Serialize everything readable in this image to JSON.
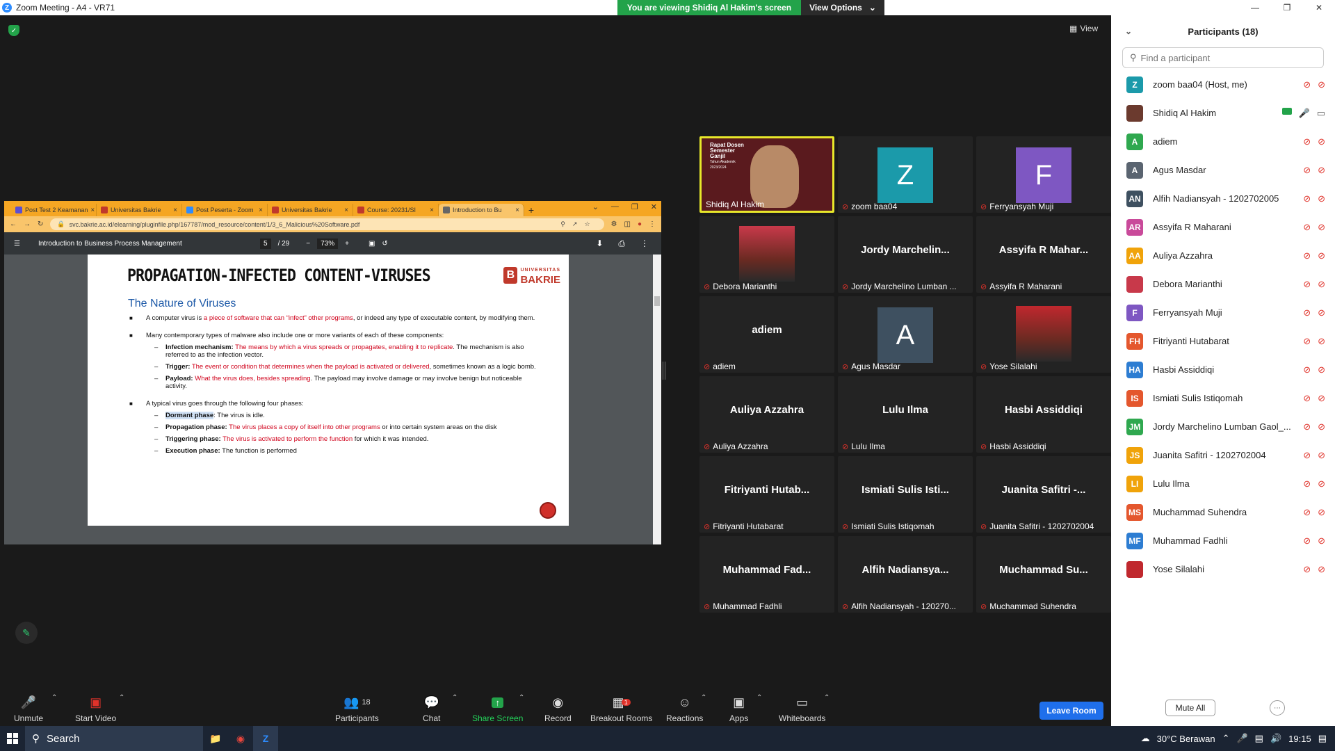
{
  "window": {
    "title": "Zoom Meeting - A4 - VR71"
  },
  "banner": {
    "viewing": "You are viewing Shidiq Al Hakim's screen",
    "view_options": "View Options"
  },
  "view_label": "View",
  "browser": {
    "tabs": [
      {
        "label": "Post Test 2 Keamanan",
        "color": "#5b4fd1"
      },
      {
        "label": "Universitas Bakrie",
        "color": "#c0392b"
      },
      {
        "label": "Post Peserta - Zoom",
        "color": "#2d8cff"
      },
      {
        "label": "Universitas Bakrie",
        "color": "#c0392b"
      },
      {
        "label": "Course: 20231/SI",
        "color": "#c0392b"
      },
      {
        "label": "Introduction to Bu",
        "color": "#666666"
      }
    ],
    "url": "svc.bakrie.ac.id/elearning/pluginfile.php/167787/mod_resource/content/1/3_6_Malicious%20Software.pdf",
    "pdf_title": "Introduction to Business Process Management",
    "page": "5",
    "page_total": "/ 29",
    "zoom": "73%"
  },
  "slide": {
    "title": "PROPAGATION-INFECTED CONTENT-VIRUSES",
    "logo_small": "UNIVERSITAS",
    "logo_big": "BAKRIE",
    "heading": "The Nature of Viruses",
    "b1_a": "A computer virus is ",
    "b1_red": "a piece of software that can “infect” other programs",
    "b1_b": ", or indeed any type of executable content, by modifying them.",
    "b2": "Many contemporary types of malware also include one or more variants of each of these components:",
    "s1_label": "Infection mechanism:",
    "s1_red": " The means by which a virus spreads or propagates, enabling it to replicate",
    "s1_b": ". The mechanism is also referred to as the infection vector.",
    "s2_label": "Trigger:",
    "s2_red": " The event or condition that determines when the payload is activated or delivered",
    "s2_b": ", sometimes known as a logic bomb.",
    "s3_label": "Payload:",
    "s3_red": " What the virus does, besides spreading",
    "s3_b": ". The payload may involve damage or may involve benign but noticeable activity.",
    "b3": "A typical virus goes through the following four phases:",
    "p1_label": "Dormant phase",
    "p1_b": ": The virus is idle.",
    "p2_label": "Propagation phase:",
    "p2_red": " The virus places a copy of itself into other programs",
    "p2_b": " or into certain system areas on the disk",
    "p3_label": "Triggering phase:",
    "p3_red": " The virus is activated to perform the function",
    "p3_b": " for which it was intended.",
    "p4_label": "Execution phase:",
    "p4_b": " The function is performed"
  },
  "tiles": [
    {
      "caption": "Shidiq Al Hakim",
      "type": "slide",
      "slide_text": "Rapat Dosen Semester Ganjil",
      "slide_sub": "Tahun Akademik 2023/2024"
    },
    {
      "caption": "zoom baa04",
      "type": "letter",
      "letter": "Z",
      "color": "#1b9aaa"
    },
    {
      "caption": "Ferryansyah Muji",
      "type": "letter",
      "letter": "F",
      "color": "#7e57c2"
    },
    {
      "caption": "Debora Marianthi",
      "type": "photo",
      "color": "#c8394a"
    },
    {
      "caption": "Jordy Marchelino Lumban ...",
      "type": "name",
      "name": "Jordy Marchelin..."
    },
    {
      "caption": "Assyifa R Maharani",
      "type": "name",
      "name": "Assyifa R Mahar..."
    },
    {
      "caption": "adiem",
      "type": "name",
      "name": "adiem"
    },
    {
      "caption": "Agus Masdar",
      "type": "letter",
      "letter": "A",
      "color": "#3e5060"
    },
    {
      "caption": "Yose Silalahi",
      "type": "photo",
      "color": "#c0282e"
    },
    {
      "caption": "Auliya Azzahra",
      "type": "name",
      "name": "Auliya Azzahra"
    },
    {
      "caption": "Lulu Ilma",
      "type": "name",
      "name": "Lulu Ilma"
    },
    {
      "caption": "Hasbi Assiddiqi",
      "type": "name",
      "name": "Hasbi Assiddiqi"
    },
    {
      "caption": "Fitriyanti Hutabarat",
      "type": "name",
      "name": "Fitriyanti Hutab..."
    },
    {
      "caption": "Ismiati Sulis Istiqomah",
      "type": "name",
      "name": "Ismiati Sulis Isti..."
    },
    {
      "caption": "Juanita Safitri - 1202702004",
      "type": "name",
      "name": "Juanita Safitri -..."
    },
    {
      "caption": "Muhammad Fadhli",
      "type": "name",
      "name": "Muhammad Fad..."
    },
    {
      "caption": "Alfih Nadiansyah - 120270...",
      "type": "name",
      "name": "Alfih Nadiansya..."
    },
    {
      "caption": "Muchammad Suhendra",
      "type": "name",
      "name": "Muchammad Su..."
    }
  ],
  "toolbar": {
    "unmute": "Unmute",
    "start_video": "Start Video",
    "participants": "Participants",
    "participants_count": "18",
    "chat": "Chat",
    "share_screen": "Share Screen",
    "record": "Record",
    "breakout_rooms": "Breakout Rooms",
    "breakout_badge": "1",
    "reactions": "Reactions",
    "apps": "Apps",
    "whiteboards": "Whiteboards",
    "leave": "Leave Room"
  },
  "panel": {
    "title": "Participants (18)",
    "search_placeholder": "Find a participant",
    "mute_all": "Mute All",
    "participants": [
      {
        "initials": "Z",
        "name": "zoom baa04 (Host, me)",
        "color": "#1b9aaa"
      },
      {
        "initials": "",
        "name": "Shidiq Al Hakim",
        "color": "#6b3a2e"
      },
      {
        "initials": "A",
        "name": "adiem",
        "color": "#2fa84f"
      },
      {
        "initials": "A",
        "name": "Agus Masdar",
        "color": "#5a6470"
      },
      {
        "initials": "AN",
        "name": "Alfih Nadiansyah - 1202702005",
        "color": "#3e5060"
      },
      {
        "initials": "AR",
        "name": "Assyifa R Maharani",
        "color": "#c94a9a"
      },
      {
        "initials": "AA",
        "name": "Auliya Azzahra",
        "color": "#f0a30a"
      },
      {
        "initials": "",
        "name": "Debora Marianthi",
        "color": "#c8394a"
      },
      {
        "initials": "F",
        "name": "Ferryansyah Muji",
        "color": "#7e57c2"
      },
      {
        "initials": "FH",
        "name": "Fitriyanti Hutabarat",
        "color": "#e4572e"
      },
      {
        "initials": "HA",
        "name": "Hasbi Assiddiqi",
        "color": "#2d7dd2"
      },
      {
        "initials": "IS",
        "name": "Ismiati Sulis Istiqomah",
        "color": "#e4572e"
      },
      {
        "initials": "JM",
        "name": "Jordy Marchelino Lumban Gaol_...",
        "color": "#2fa84f"
      },
      {
        "initials": "JS",
        "name": "Juanita Safitri - 1202702004",
        "color": "#f0a30a"
      },
      {
        "initials": "LI",
        "name": "Lulu Ilma",
        "color": "#f0a30a"
      },
      {
        "initials": "MS",
        "name": "Muchammad Suhendra",
        "color": "#e4572e"
      },
      {
        "initials": "MF",
        "name": "Muhammad Fadhli",
        "color": "#2d7dd2"
      },
      {
        "initials": "",
        "name": "Yose Silalahi",
        "color": "#c0282e"
      }
    ]
  },
  "taskbar": {
    "search": "Search",
    "weather": "30°C Berawan",
    "time": "19:15"
  }
}
